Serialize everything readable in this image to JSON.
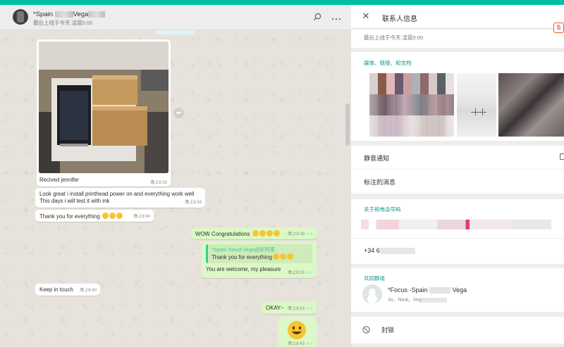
{
  "chat": {
    "contact_name_prefix": "*Spain",
    "contact_name_suffix": "Vega",
    "last_seen": "最后上线于今天 凌晨5:00",
    "photo_caption": "Recived jennifer",
    "photo_time": "晚上8:33",
    "messages": [
      {
        "text": "Look great i install printhead power on and everything work well",
        "text2": "This days i will test it with ink",
        "time": "晚上8:34",
        "dir": "in"
      },
      {
        "text": "Thank you for everything",
        "time": "晚上8:34",
        "dir": "in"
      },
      {
        "text": "WOW Congratulations",
        "time": "晚上8:38",
        "dir": "out"
      },
      {
        "quote_name": "*Spain David Vega益彩阿里",
        "quote_text": "Thank you for everything",
        "text": "You are welcome, my pleasure",
        "time": "晚上8:39",
        "dir": "out"
      },
      {
        "text": "Keep in touch",
        "time": "晚上8:40",
        "dir": "in"
      },
      {
        "text": "OKAY~",
        "time": "晚上8:43",
        "dir": "out"
      },
      {
        "text": "",
        "time": "晚上8:43",
        "dir": "out"
      }
    ]
  },
  "info": {
    "title": "联系人信息",
    "last_seen": "最后上线于今天 凌晨5:00",
    "media_label": "媒体、链接、和文档",
    "mute_label": "静音通知",
    "starred_label": "标注的消息",
    "about_label": "关于和电话号码",
    "phone_prefix": "+34 6",
    "groups_label": "共同群组",
    "group_name_prefix": "*Focus -Spain",
    "group_name_suffix": "Vega",
    "group_members": "Jo，Neal，Veg",
    "block_label": "封锁"
  },
  "colors": {
    "accent": "#00bfa5",
    "outgoing": "#dcf8c6",
    "section": "#009688",
    "read_ticks": "#4fc3f7"
  },
  "icons": [
    "search-icon",
    "menu-dots-icon",
    "close-icon",
    "forward-icon",
    "block-icon",
    "sogou-icon"
  ]
}
